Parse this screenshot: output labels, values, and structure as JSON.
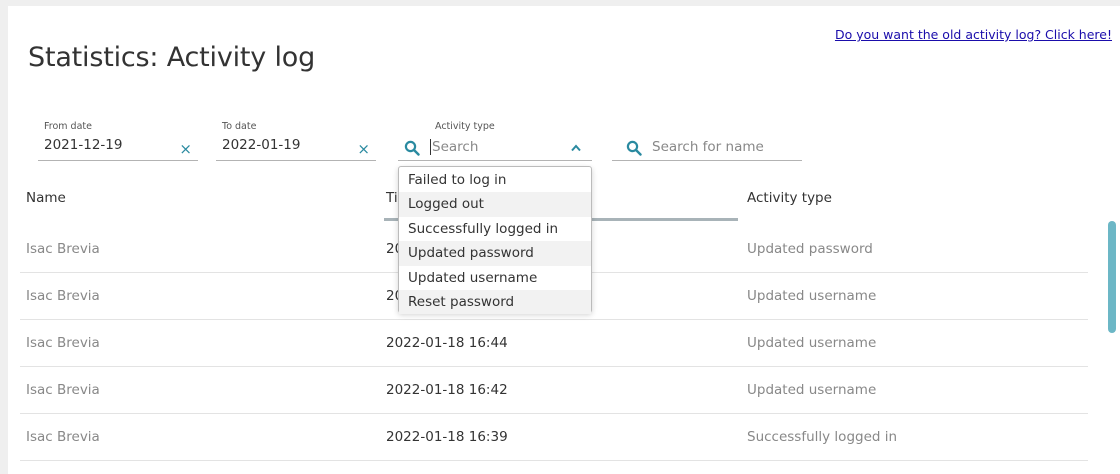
{
  "header": {
    "title": "Statistics: Activity log",
    "old_log_link": "Do you want the old activity log? Click here!"
  },
  "filters": {
    "from_date": {
      "label": "From date",
      "value": "2021-12-19"
    },
    "to_date": {
      "label": "To date",
      "value": "2022-01-19"
    },
    "activity_type": {
      "label": "Activity type",
      "placeholder": "Search"
    },
    "name_search": {
      "placeholder": "Search for name"
    },
    "clear_glyph": "×"
  },
  "dropdown": {
    "items": [
      "Failed to log in",
      "Logged out",
      "Successfully logged in",
      "Updated password",
      "Updated username",
      "Reset password"
    ]
  },
  "table": {
    "columns": [
      "Name",
      "Ti",
      "Activity type"
    ],
    "rows": [
      {
        "name": "Isac Brevia",
        "time": "20",
        "activity": "Updated password"
      },
      {
        "name": "Isac Brevia",
        "time": "20",
        "activity": "Updated username"
      },
      {
        "name": "Isac Brevia",
        "time": "2022-01-18 16:44",
        "activity": "Updated username"
      },
      {
        "name": "Isac Brevia",
        "time": "2022-01-18 16:42",
        "activity": "Updated username"
      },
      {
        "name": "Isac Brevia",
        "time": "2022-01-18 16:39",
        "activity": "Successfully logged in"
      }
    ]
  },
  "colors": {
    "accent": "#2a8aa0",
    "scrollbar": "#6cb7c6",
    "link": "#1a0dab"
  }
}
